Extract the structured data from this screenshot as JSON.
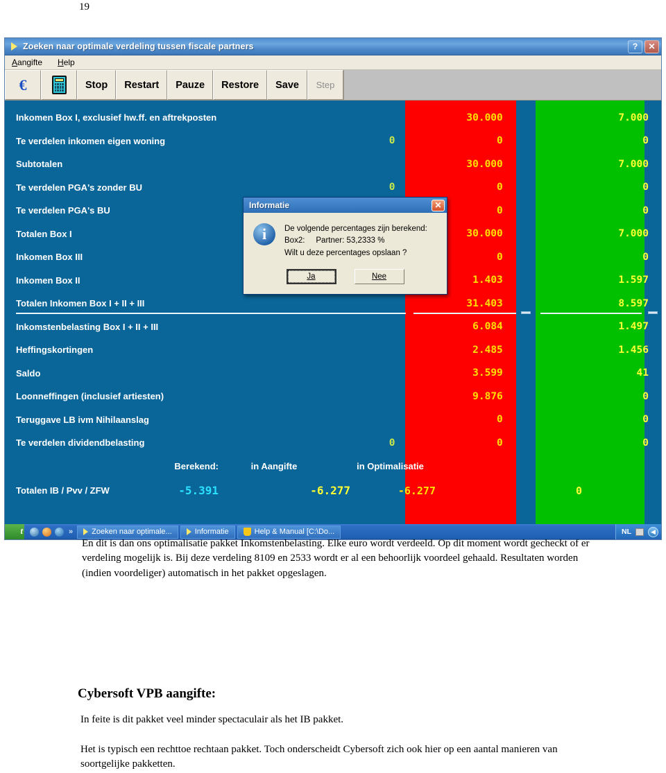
{
  "page": {
    "number": "19"
  },
  "window": {
    "title": "Zoeken naar optimale verdeling tussen fiscale partners",
    "help_button": "?",
    "close_button": "✕",
    "menu": [
      {
        "label": "Aangifte",
        "accel": "A"
      },
      {
        "label": "Help",
        "accel": "H"
      }
    ],
    "toolbar": {
      "euro_icon": "€",
      "calculator_icon": "calculator-icon",
      "buttons": [
        {
          "label": "Stop",
          "disabled": false
        },
        {
          "label": "Restart",
          "disabled": false
        },
        {
          "label": "Pauze",
          "disabled": false
        },
        {
          "label": "Restore",
          "disabled": false
        },
        {
          "label": "Save",
          "disabled": false
        },
        {
          "label": "Step",
          "disabled": true
        }
      ]
    }
  },
  "grid": {
    "rows": [
      {
        "label": "Inkomen Box I, exclusief hw.ff. en aftrekposten",
        "blue": "",
        "red": "30.000",
        "green": "7.000"
      },
      {
        "label": "Te verdelen inkomen eigen woning",
        "blue": "0",
        "red": "0",
        "green": "0"
      },
      {
        "label": "Subtotalen",
        "blue": "",
        "red": "30.000",
        "green": "7.000"
      },
      {
        "label": "Te verdelen PGA's zonder BU",
        "blue": "0",
        "red": "0",
        "green": "0"
      },
      {
        "label": "Te verdelen PGA's BU",
        "blue": "",
        "red": "0",
        "green": "0"
      },
      {
        "label": "Totalen Box I",
        "blue": "",
        "red": "30.000",
        "green": "7.000"
      },
      {
        "label": "Inkomen Box III",
        "blue": "",
        "red": "0",
        "green": "0"
      },
      {
        "label": "Inkomen Box II",
        "blue": "",
        "red": "1.403",
        "green": "1.597"
      },
      {
        "label": "Totalen Inkomen Box I + II + III",
        "blue": "",
        "red": "31.403",
        "green": "8.597"
      },
      {
        "label": "Inkomstenbelasting Box I + II + III",
        "blue": "",
        "red": "6.084",
        "green": "1.497"
      },
      {
        "label": "Heffingskortingen",
        "blue": "",
        "red": "2.485",
        "green": "1.456"
      },
      {
        "label": "Saldo",
        "blue": "",
        "red": "3.599",
        "green": "41"
      },
      {
        "label": "Loonneffingen (inclusief artiesten)",
        "blue": "",
        "red": "9.876",
        "green": "0"
      },
      {
        "label": "Teruggave LB ivm Nihilaanslag",
        "blue": "",
        "red": "0",
        "green": "0"
      },
      {
        "label": "Te verdelen dividendbelasting",
        "blue": "0",
        "red": "0",
        "green": "0"
      }
    ],
    "footer": {
      "berekend_label": "Berekend:",
      "aangifte_header": "in Aangifte",
      "optimalisatie_header": "in Optimalisatie",
      "total_label": "Totalen IB / Pvv / ZFW",
      "total_aangifte": "-5.391",
      "total_optimalisatie": "-6.277",
      "total_red": "-6.277",
      "total_green": "0"
    }
  },
  "dialog": {
    "title": "Informatie",
    "close_button": "✕",
    "icon": "info-icon",
    "line1": "De volgende percentages zijn berekend:",
    "line2": "Box2:     Partner: 53,2333 %",
    "line3": "Wilt u deze percentages opslaan ?",
    "yes_button": "Ja",
    "no_button": "Nee"
  },
  "taskbar": {
    "items": [
      {
        "label": "Zoeken naar optimale...",
        "icon": "play-icon"
      },
      {
        "label": "Informatie",
        "icon": "play-icon"
      },
      {
        "label": "Help & Manual [C:\\Do...",
        "icon": "shield-icon"
      }
    ],
    "tray": {
      "language": "NL",
      "clock_icon": "keyboard-icon",
      "volume_icon": "speaker-icon"
    }
  },
  "document": {
    "intro": "En dit is dan ons optimalisatie pakket Inkomstenbelasting. Elke euro wordt verdeeld. Op dit moment wordt gecheckt of er verdeling mogelijk is. Bij deze verdeling 8109 en 2533 wordt er al een behoorlijk voordeel gehaald. Resultaten worden (indien voordeliger) automatisch in het pakket opgeslagen.",
    "heading": "Cybersoft VPB aangifte:",
    "para1": "In feite is dit pakket veel minder spectaculair als het IB pakket.",
    "para2": "Het is typisch een rechttoe rechtaan pakket. Toch onderscheidt Cybersoft zich ook hier op een aantal manieren van soortgelijke pakketten."
  }
}
